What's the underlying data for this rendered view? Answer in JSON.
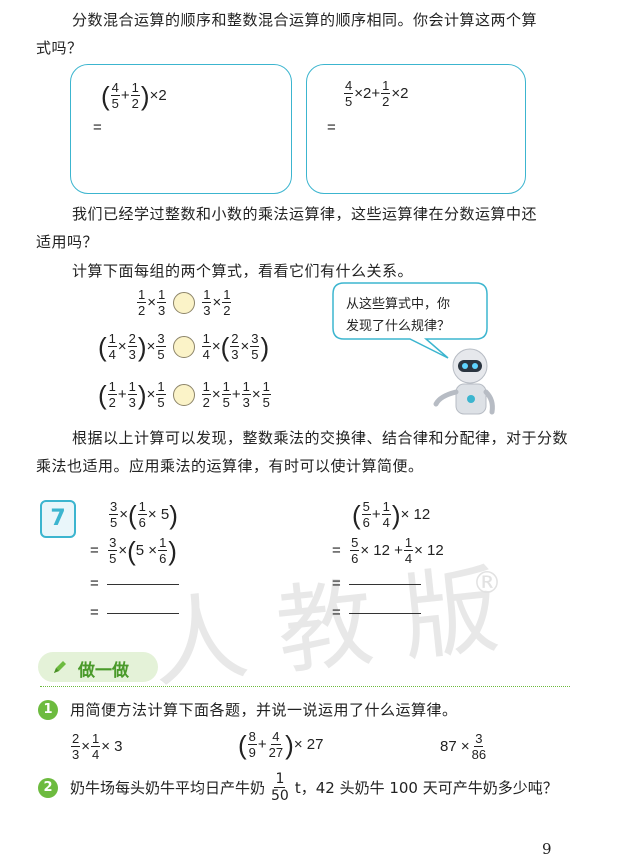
{
  "intro": {
    "line1": "分数混合运算的顺序和整数混合运算的顺序相同。你会计算这两个算",
    "line2": "式吗？"
  },
  "box_left": {
    "expr": [
      "4",
      "5",
      "1",
      "2",
      "×2"
    ],
    "eq": "="
  },
  "box_right": {
    "expr": [
      "4",
      "5",
      "×2+",
      "1",
      "2",
      "×2"
    ],
    "eq": "="
  },
  "laws_para": {
    "line1": "我们已经学过整数和小数的乘法运算律，这些运算律在分数运算中还",
    "line2": "适用吗？"
  },
  "compute_prompt": "计算下面每组的两个算式，看看它们有什么关系。",
  "speech_bubble": {
    "line1": "从这些算式中，你",
    "line2": "发现了什么规律？"
  },
  "conclusion": {
    "line1": "根据以上计算可以发现，整数乘法的交换律、结合律和分配律，对于分数",
    "line2": "乘法也适用。应用乘法的运算律，有时可以使计算简便。"
  },
  "example": {
    "number": "7",
    "eq": "="
  },
  "watermark": {
    "text": "人教版",
    "reg": "®"
  },
  "practice": {
    "title": "做一做",
    "q1_num": "1",
    "q1_text": "用简便方法计算下面各题，并说一说运用了什么运算律。",
    "q2_num": "2",
    "q2_text_a": "奶牛场每头奶牛平均日产牛奶",
    "q2_frac_n": "1",
    "q2_frac_d": "50",
    "q2_text_b": "t，42 头奶牛 100 天可产牛奶多少吨？"
  },
  "page_number": "9",
  "colors": {
    "accent": "#3cb5cf",
    "green": "#6dbb3f",
    "circle": "#fbf3c8"
  }
}
